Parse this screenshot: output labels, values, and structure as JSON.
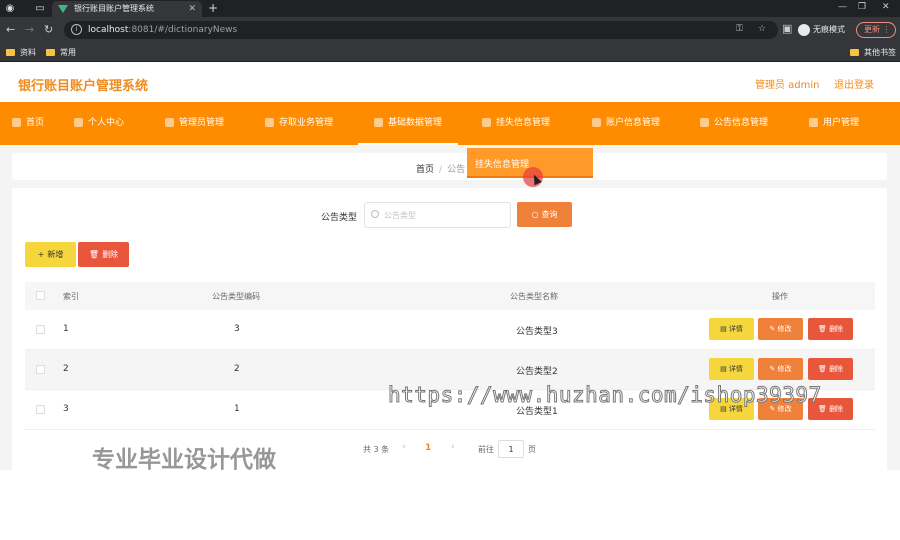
{
  "browser": {
    "tab_title": "银行账目账户管理系统",
    "url_host": "localhost",
    "url_path": ":8081/#/dictionaryNews",
    "incognito_label": "无痕模式",
    "update_label": "更新",
    "bookmarks": [
      "资料",
      "常用"
    ],
    "other_bookmarks": "其他书签"
  },
  "header": {
    "title": "银行账目账户管理系统",
    "user": "管理员 admin",
    "logout": "退出登录"
  },
  "menu": {
    "items": [
      "首页",
      "个人中心",
      "管理员管理",
      "存取业务管理",
      "基础数据管理",
      "挂失信息管理",
      "账户信息管理",
      "公告信息管理",
      "用户管理"
    ],
    "dropdown_item": "挂失信息管理"
  },
  "breadcrumb": {
    "home": "首页",
    "current": "公告"
  },
  "search": {
    "label": "公告类型",
    "placeholder": "公告类型",
    "query_button": "查询"
  },
  "actions": {
    "add": "新增",
    "delete": "删除"
  },
  "table": {
    "headers": [
      "索引",
      "公告类型编码",
      "公告类型名称",
      "操作"
    ],
    "rows": [
      {
        "index": "1",
        "code": "3",
        "name": "公告类型3"
      },
      {
        "index": "2",
        "code": "2",
        "name": "公告类型2"
      },
      {
        "index": "3",
        "code": "1",
        "name": "公告类型1"
      }
    ],
    "row_buttons": {
      "detail": "详情",
      "edit": "修改",
      "delete": "删除"
    }
  },
  "pagination": {
    "total": "共 3 条",
    "current_page": "1",
    "goto_label": "前往",
    "goto_value": "1",
    "page_suffix": "页"
  },
  "watermarks": {
    "url": "https://www.huzhan.com/ishop39397",
    "text": "专业毕业设计代做"
  }
}
